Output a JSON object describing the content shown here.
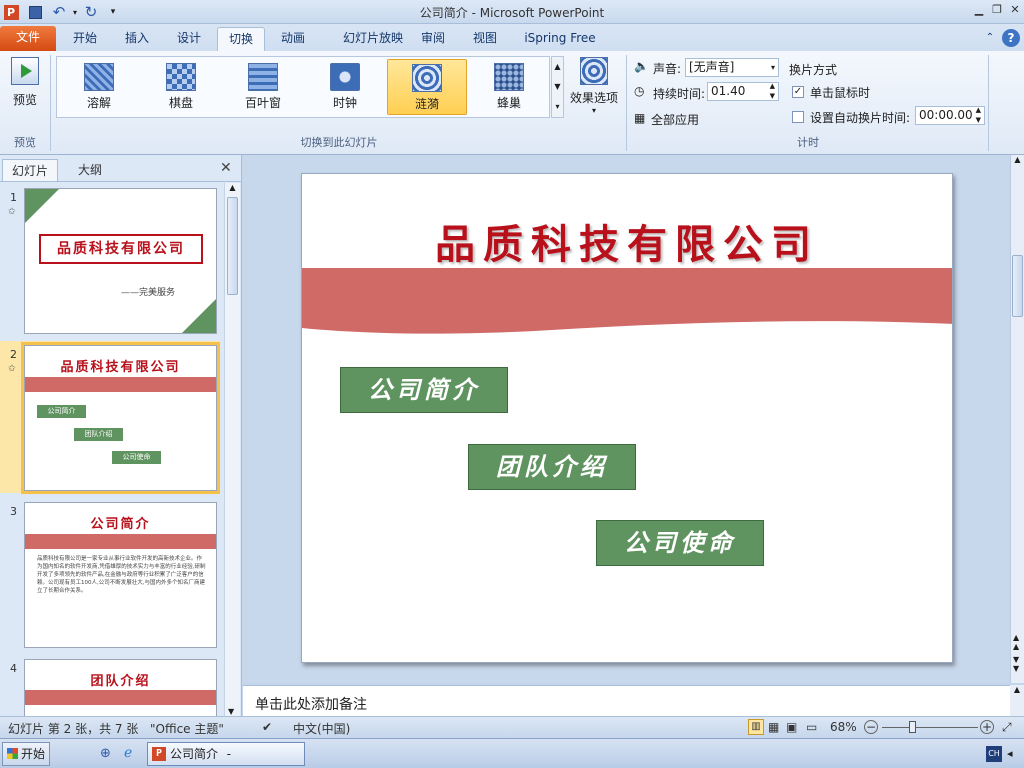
{
  "window": {
    "title": "公司简介 - Microsoft PowerPoint"
  },
  "tabs": [
    {
      "label": "文件"
    },
    {
      "label": "开始"
    },
    {
      "label": "插入"
    },
    {
      "label": "设计"
    },
    {
      "label": "切换"
    },
    {
      "label": "动画"
    },
    {
      "label": "幻灯片放映"
    },
    {
      "label": "审阅"
    },
    {
      "label": "视图"
    },
    {
      "label": "iSpring Free"
    }
  ],
  "ribbon": {
    "preview": {
      "label": "预览",
      "group": "预览"
    },
    "transitions": [
      {
        "label": "溶解"
      },
      {
        "label": "棋盘"
      },
      {
        "label": "百叶窗"
      },
      {
        "label": "时钟"
      },
      {
        "label": "涟漪"
      },
      {
        "label": "蜂巢"
      }
    ],
    "effect_options": "效果选项",
    "transitions_group": "切换到此幻灯片",
    "sound_label": "声音:",
    "sound_value": "[无声音]",
    "duration_label": "持续时间:",
    "duration_value": "01.40",
    "apply_all": "全部应用",
    "advance_title": "换片方式",
    "on_click": "单击鼠标时",
    "after_time": "设置自动换片时间:",
    "after_time_value": "00:00.00",
    "timing_group": "计时"
  },
  "left_pane": {
    "tab_slides": "幻灯片",
    "tab_outline": "大纲",
    "thumbs": [
      {
        "num": "1",
        "title": "品质科技有限公司",
        "subtitle": "——完美服务"
      },
      {
        "num": "2",
        "title": "品质科技有限公司",
        "items": [
          "公司简介",
          "团队介绍",
          "公司使命"
        ]
      },
      {
        "num": "3",
        "title": "公司简介",
        "body": "品质科技有限公司是一家专业从事行业软件开发的高新技术企业。作为国内知名的软件开发商,凭借雄厚的技术实力与丰富的行业经验,研制开发了多项领先的软件产品,在金融与政府等行业积累了广泛客户的信赖。公司现有员工100人,公司不断发展壮大,与国内外多个知名厂商建立了长期合作关系。"
      },
      {
        "num": "4",
        "title": "团队介绍"
      }
    ]
  },
  "slide": {
    "title": "品质科技有限公司",
    "items": [
      "公司简介",
      "团队介绍",
      "公司使命"
    ]
  },
  "notes": {
    "placeholder": "单击此处添加备注"
  },
  "status": {
    "slide_info": "幻灯片 第 2 张，共 7 张",
    "theme": "\"Office 主题\"",
    "language": "中文(中国)",
    "zoom": "68%"
  },
  "taskbar": {
    "start": "开始",
    "app_button": "公司简介 - Microsof...",
    "ime": "CH"
  },
  "colors": {
    "accent": "#b8111b",
    "band": "#cf6a67",
    "box": "#5f9360",
    "file_tab": "#e25a1c"
  }
}
